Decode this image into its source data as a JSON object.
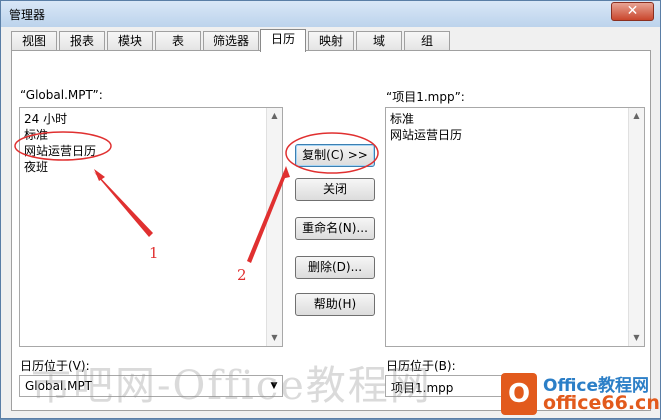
{
  "window": {
    "title": "管理器",
    "close_glyph": "✕"
  },
  "tabs": [
    {
      "label": "视图"
    },
    {
      "label": "报表"
    },
    {
      "label": "模块"
    },
    {
      "label": "表"
    },
    {
      "label": "筛选器"
    },
    {
      "label": "日历",
      "active": true
    },
    {
      "label": "映射"
    },
    {
      "label": "域"
    },
    {
      "label": "组"
    }
  ],
  "left_list": {
    "header": "“Global.MPT”:",
    "items": [
      "24 小时",
      "标准",
      "网站运营日历",
      "夜班"
    ]
  },
  "right_list": {
    "header": "“项目1.mpp”:",
    "items": [
      "标准",
      "网站运营日历"
    ]
  },
  "buttons": {
    "copy": "复制(C) >>",
    "close": "关闭",
    "rename": "重命名(N)...",
    "delete": "删除(D)...",
    "help": "帮助(H)"
  },
  "bottom": {
    "left_label": "日历位于(V):",
    "left_value": "Global.MPT",
    "right_label": "日历位于(B):",
    "right_value": "项目1.mpp"
  },
  "annotations": {
    "one": "1",
    "two": "2"
  },
  "watermark": "市吧网-Office教程网",
  "logo": {
    "letter": "O",
    "line1": "Office教程网",
    "line2": "office66.cn"
  },
  "colors": {
    "annotation": "#e03030",
    "logo_orange": "#e25a1c",
    "logo_blue": "#2c7fc7"
  }
}
